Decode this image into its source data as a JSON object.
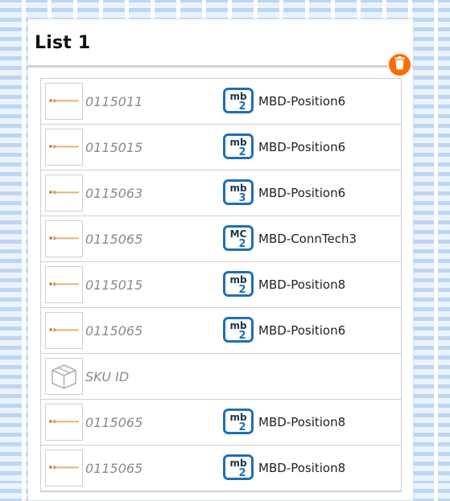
{
  "list": {
    "title": "List 1",
    "delete_icon": "trash-icon",
    "accent_color": "#ff6a00",
    "badge_color": "#1f6fb6",
    "items": [
      {
        "thumb": "screw",
        "sku": "0115011",
        "badge_code": "mb",
        "badge_number": "2",
        "name": "MBD-Position6"
      },
      {
        "thumb": "screw",
        "sku": "0115015",
        "badge_code": "mb",
        "badge_number": "2",
        "name": "MBD-Position6"
      },
      {
        "thumb": "screw",
        "sku": "0115063",
        "badge_code": "mb",
        "badge_number": "3",
        "name": "MBD-Position6"
      },
      {
        "thumb": "screw",
        "sku": "0115065",
        "badge_code": "MC",
        "badge_number": "2",
        "name": "MBD-ConnTech3"
      },
      {
        "thumb": "screw",
        "sku": "0115015",
        "badge_code": "mb",
        "badge_number": "2",
        "name": "MBD-Position8"
      },
      {
        "thumb": "screw",
        "sku": "0115065",
        "badge_code": "mb",
        "badge_number": "2",
        "name": "MBD-Position6"
      },
      {
        "thumb": "box",
        "sku": "SKU ID",
        "badge_code": "",
        "badge_number": "",
        "name": ""
      },
      {
        "thumb": "screw",
        "sku": "0115065",
        "badge_code": "mb",
        "badge_number": "2",
        "name": "MBD-Position8"
      },
      {
        "thumb": "screw",
        "sku": "0115065",
        "badge_code": "mb",
        "badge_number": "2",
        "name": "MBD-Position8"
      }
    ]
  }
}
